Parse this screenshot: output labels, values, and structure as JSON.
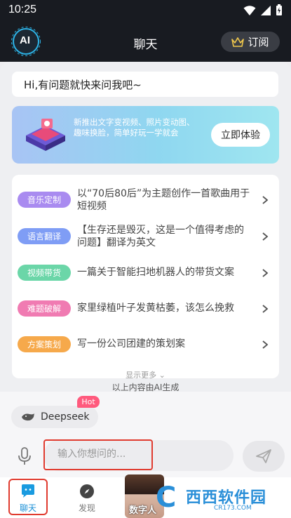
{
  "status_bar": {
    "time": "10:25"
  },
  "header": {
    "logo_text": "AI",
    "title": "聊天",
    "subscribe_label": "订阅"
  },
  "greeting": "Hi,有问题就快来问我吧~",
  "banner": {
    "text": "新推出文字变视频、照片变动图、趣味换脸，简单好玩一学就会",
    "cta": "立即体验"
  },
  "suggestions": [
    {
      "tag": "音乐定制",
      "tag_color": "#a98bf0",
      "text": "以“70后80后”为主题创作一首歌曲用于短视频"
    },
    {
      "tag": "语言翻译",
      "tag_color": "#7f9df5",
      "text": "【生存还是毁灭，这是一个值得考虑的问题】翻译为英文"
    },
    {
      "tag": "视频带货",
      "tag_color": "#6bd6a8",
      "text": "一篇关于智能扫地机器人的带货文案"
    },
    {
      "tag": "难题破解",
      "tag_color": "#f07bb2",
      "text": "家里绿植叶子发黄枯萎，该怎么挽救"
    },
    {
      "tag": "方案策划",
      "tag_color": "#f6a94b",
      "text": "写一份公司团建的策划案"
    }
  ],
  "more_label": "显示更多",
  "footnote": "以上内容由AI生成",
  "model": {
    "name": "Deepseek",
    "badge": "Hot"
  },
  "input": {
    "placeholder": "输入你想问的..."
  },
  "tabs": [
    {
      "label": "聊天",
      "active": true
    },
    {
      "label": "发现",
      "active": false
    },
    {
      "label": "数字人",
      "active": false
    }
  ],
  "watermark": {
    "text": "西西软件园",
    "sub": "CR173.COM"
  },
  "colors": {
    "header_bg": "#181b21",
    "accent": "#1a8fd6",
    "highlight_box": "#e03b2f"
  }
}
